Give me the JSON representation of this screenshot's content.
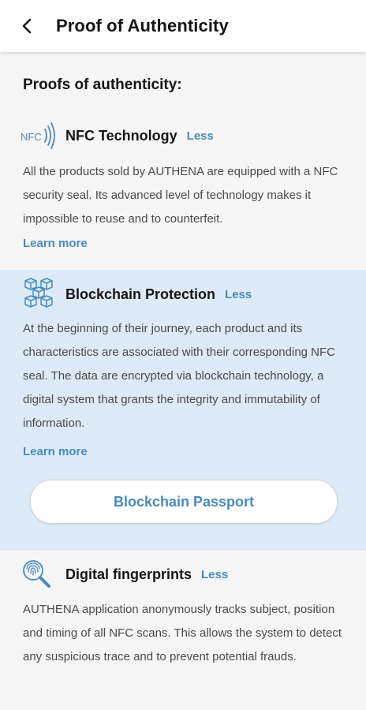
{
  "appbar": {
    "title": "Proof of Authenticity"
  },
  "section_heading": "Proofs of authenticity:",
  "cards": [
    {
      "title": "NFC Technology",
      "toggle_label": "Less",
      "icon_text": "NFC",
      "body": "All the products sold by AUTHENA are equipped with a NFC security seal. Its advanced level of technology makes it impossible to reuse and to counterfeit.",
      "learn_more": "Learn more"
    },
    {
      "title": "Blockchain Protection",
      "toggle_label": "Less",
      "body": "At the beginning of their journey, each product and its characteristics are associated with their corresponding NFC seal. The data are encrypted via blockchain technology, a digital system that grants the integrity and immutability of information.",
      "learn_more": "Learn more",
      "button_label": "Blockchain Passport"
    },
    {
      "title": "Digital fingerprints",
      "toggle_label": "Less",
      "body": "AUTHENA application anonymously tracks subject, position and timing of all NFC scans. This allows the system to detect any suspicious trace and to prevent potential frauds."
    }
  ],
  "colors": {
    "accent": "#4a8bc0",
    "highlight_background": "#dcebf7",
    "page_background": "#f6f6f6"
  },
  "icons": {
    "back": "back-arrow-icon",
    "nfc": "nfc-icon",
    "blockchain": "blockchain-icon",
    "fingerprint": "fingerprint-magnifier-icon"
  }
}
